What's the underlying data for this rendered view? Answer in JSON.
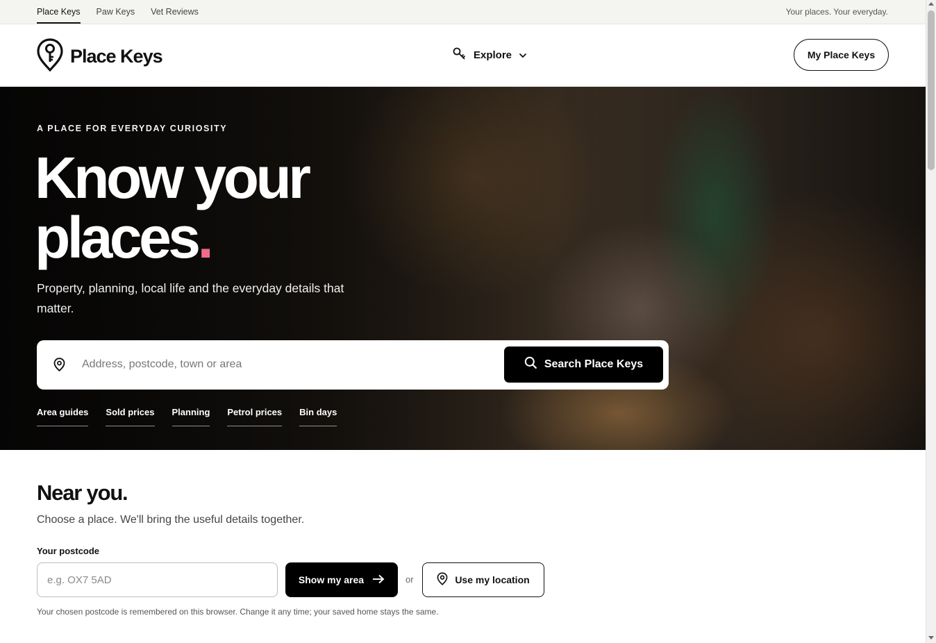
{
  "topbar": {
    "sites": [
      {
        "label": "Place Keys",
        "active": true
      },
      {
        "label": "Paw Keys",
        "active": false
      },
      {
        "label": "Vet Reviews",
        "active": false
      }
    ],
    "tagline": "Your places. Your everyday."
  },
  "header": {
    "logo_text": "Place Keys",
    "explore_label": "Explore",
    "my_keys_label": "My Place Keys"
  },
  "hero": {
    "eyebrow": "A PLACE FOR EVERYDAY CURIOSITY",
    "headline_line1": "Know your",
    "headline_line2": "places",
    "headline_dot": ".",
    "subhead": "Property, planning, local life and the everyday details that matter.",
    "search_placeholder": "Address, postcode, town or area",
    "search_button": "Search Place Keys",
    "quick_links": [
      "Area guides",
      "Sold prices",
      "Planning",
      "Petrol prices",
      "Bin days"
    ]
  },
  "near_you": {
    "title": "Near you.",
    "subtitle": "Choose a place. We'll bring the useful details together.",
    "postcode_label": "Your postcode",
    "postcode_placeholder": "e.g. OX7 5AD",
    "show_button": "Show my area",
    "or_text": "or",
    "location_button": "Use my location",
    "note": "Your chosen postcode is remembered on this browser. Change it any time; your saved home stays the same."
  },
  "colors": {
    "accent_dot": "#f06a8a",
    "primary_button": "#000000",
    "topbar_bg": "#f4f4f1"
  },
  "icons": [
    "logo-pin-key-icon",
    "key-icon",
    "chevron-down-icon",
    "location-pin-icon",
    "search-icon",
    "arrow-right-icon"
  ]
}
